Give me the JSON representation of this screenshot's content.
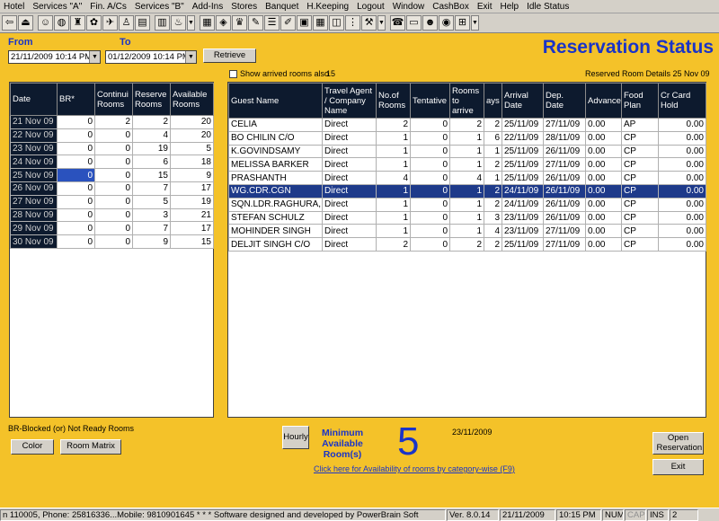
{
  "menu": [
    "Hotel",
    "Services \"A\"",
    "Fin. A/Cs",
    "Services \"B\"",
    "Add-Ins",
    "Stores",
    "Banquet",
    "H.Keeping",
    "Logout",
    "Window",
    "CashBox",
    "Exit",
    "Help",
    "Idle Status"
  ],
  "toolbar_icons": [
    "back-arrow",
    "exit-door",
    "smiley",
    "globe",
    "hat",
    "spinner",
    "bird",
    "person",
    "reports",
    "chart",
    "food",
    "dropdown",
    "menu-card",
    "cake",
    "bar",
    "pen",
    "list",
    "edit",
    "calculator",
    "grid",
    "wallet",
    "traffic-light",
    "tools",
    "dropdown",
    "phone",
    "screen",
    "people",
    "world",
    "windows",
    "dropdown"
  ],
  "title": "Reservation Status",
  "from_label": "From",
  "to_label": "To",
  "from_value": "21/11/2009 10:14 PM",
  "to_value": "01/12/2009 10:14 PM",
  "retrieve_label": "Retrieve",
  "show_arrived_label": "Show arrived rooms also",
  "arrived_count": "15",
  "reserved_details": "Reserved Room Details 25 Nov 09",
  "left_grid": {
    "headers": [
      "Date",
      "BR*",
      "Continui Rooms",
      "Reserve Rooms",
      "Available Rooms"
    ],
    "rows": [
      [
        "21 Nov 09",
        "0",
        "2",
        "2",
        "20"
      ],
      [
        "22 Nov 09",
        "0",
        "0",
        "4",
        "20"
      ],
      [
        "23 Nov 09",
        "0",
        "0",
        "19",
        "5"
      ],
      [
        "24 Nov 09",
        "0",
        "0",
        "6",
        "18"
      ],
      [
        "25 Nov 09",
        "0",
        "0",
        "15",
        "9"
      ],
      [
        "26 Nov 09",
        "0",
        "0",
        "7",
        "17"
      ],
      [
        "27 Nov 09",
        "0",
        "0",
        "5",
        "19"
      ],
      [
        "28 Nov 09",
        "0",
        "0",
        "3",
        "21"
      ],
      [
        "29 Nov 09",
        "0",
        "0",
        "7",
        "17"
      ],
      [
        "30 Nov 09",
        "0",
        "0",
        "9",
        "15"
      ]
    ]
  },
  "right_grid": {
    "headers": [
      "Guest Name",
      "Travel Agent / Company Name",
      "No.of Rooms",
      "Tentative",
      "Rooms to arrive",
      "ays",
      "Arrival Date",
      "Dep. Date",
      "Advance",
      "Food Plan",
      "Cr Card Hold"
    ],
    "rows": [
      [
        "CELIA",
        "Direct",
        "2",
        "0",
        "2",
        "2",
        "25/11/09",
        "27/11/09",
        "0.00",
        "AP",
        "0.00"
      ],
      [
        "BO CHILIN C/O",
        "Direct",
        "1",
        "0",
        "1",
        "6",
        "22/11/09",
        "28/11/09",
        "0.00",
        "CP",
        "0.00"
      ],
      [
        "K.GOVINDSAMY",
        "Direct",
        "1",
        "0",
        "1",
        "1",
        "25/11/09",
        "26/11/09",
        "0.00",
        "CP",
        "0.00"
      ],
      [
        "MELISSA BARKER",
        "Direct",
        "1",
        "0",
        "1",
        "2",
        "25/11/09",
        "27/11/09",
        "0.00",
        "CP",
        "0.00"
      ],
      [
        "PRASHANTH",
        "Direct",
        "4",
        "0",
        "4",
        "1",
        "25/11/09",
        "26/11/09",
        "0.00",
        "CP",
        "0.00"
      ],
      [
        "WG.CDR.CGN",
        "Direct",
        "1",
        "0",
        "1",
        "2",
        "24/11/09",
        "26/11/09",
        "0.00",
        "CP",
        "0.00"
      ],
      [
        "SQN.LDR.RAGHURA,",
        "Direct",
        "1",
        "0",
        "1",
        "2",
        "24/11/09",
        "26/11/09",
        "0.00",
        "CP",
        "0.00"
      ],
      [
        "STEFAN SCHULZ",
        "Direct",
        "1",
        "0",
        "1",
        "3",
        "23/11/09",
        "26/11/09",
        "0.00",
        "CP",
        "0.00"
      ],
      [
        "MOHINDER SINGH",
        "Direct",
        "1",
        "0",
        "1",
        "4",
        "23/11/09",
        "27/11/09",
        "0.00",
        "CP",
        "0.00"
      ],
      [
        "DELJIT SINGH C/O",
        "Direct",
        "2",
        "0",
        "2",
        "2",
        "25/11/09",
        "27/11/09",
        "0.00",
        "CP",
        "0.00"
      ]
    ]
  },
  "br_note": "BR-Blocked (or) Not Ready Rooms",
  "color_button": "Color",
  "room_matrix_button": "Room Matrix",
  "hourly_button": "Hourly",
  "minimum_label": "Minimum Available Room(s)",
  "minimum_value": "5",
  "current_date": "23/11/2009",
  "category_link": "Click here for Availability of rooms by category-wise (F9)",
  "open_reservation_button": "Open Reservation",
  "exit_button": "Exit",
  "status": {
    "contact": "n 110005, Phone: 25816336...Mobile: 9810901645 * * * Software designed and developed by PowerBrain Soft",
    "version": "Ver. 8.0.14",
    "date": "21/11/2009",
    "time": "10:15 PM",
    "num": "NUM",
    "cap": "CAP",
    "ins": "INS",
    "count": "2"
  }
}
